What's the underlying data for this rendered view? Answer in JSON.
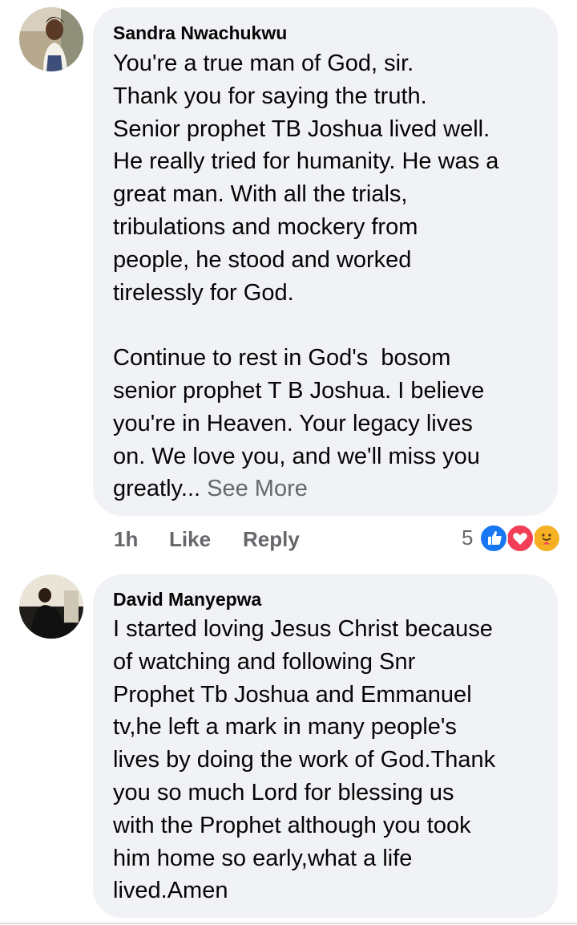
{
  "comments": [
    {
      "author": "Sandra Nwachukwu",
      "text": "You're a true man of God, sir.\nThank you for saying the truth.\nSenior prophet TB Joshua lived well.\nHe really tried for humanity. He was a\ngreat man. With all the trials,\ntribulations and mockery from\npeople, he stood and worked\ntirelessly for God.\n\nContinue to rest in God's  bosom\nsenior prophet T B Joshua. I believe\nyou're in Heaven. Your legacy lives\non. We love you, and we'll miss you\ngreatly...",
      "see_more": "See More",
      "time": "1h",
      "like_label": "Like",
      "reply_label": "Reply",
      "reaction_count": "5",
      "reactions": [
        "like-icon",
        "love-icon",
        "care-icon"
      ]
    },
    {
      "author": "David Manyepwa",
      "text": "I started loving Jesus Christ because\nof watching and following Snr\nProphet Tb Joshua and Emmanuel\ntv,he left a mark in many people's\nlives by doing the work of God.Thank\nyou so much Lord for blessing us\nwith the Prophet although you took\nhim home so early,what a life\nlived.Amen"
    }
  ],
  "colors": {
    "bubble": "#f0f2f5",
    "secondary_text": "#65676b",
    "like_blue": "#1877f2",
    "love_red": "#f33e58",
    "care_yellow": "#f7b125"
  }
}
